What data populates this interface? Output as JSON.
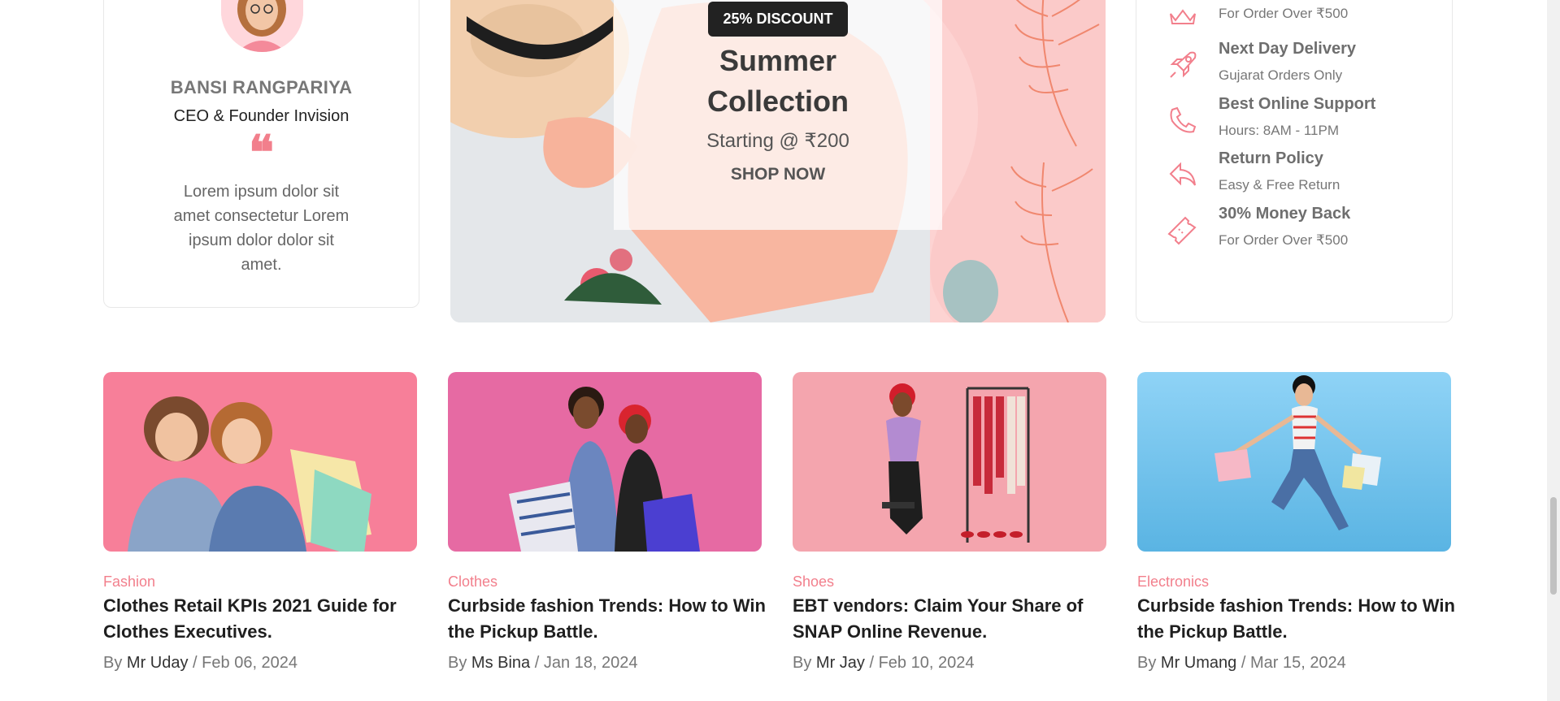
{
  "testimonial": {
    "name": "BANSI RANGPARIYA",
    "role": "CEO & Founder Invision",
    "quote_mark": "❝",
    "text": "Lorem ipsum dolor sit amet consectetur Lorem ipsum dolor dolor sit amet."
  },
  "banner": {
    "discount": "25% DISCOUNT",
    "title_line1": "Summer",
    "title_line2": "Collection",
    "subtitle": "Starting @ ₹200",
    "cta": "SHOP NOW"
  },
  "services": [
    {
      "title": "",
      "subtitle": "For Order Over ₹500",
      "icon": "crown-icon"
    },
    {
      "title": "Next Day Delivery",
      "subtitle": "Gujarat Orders Only",
      "icon": "rocket-icon"
    },
    {
      "title": "Best Online Support",
      "subtitle": "Hours: 8AM - 11PM",
      "icon": "phone-icon"
    },
    {
      "title": "Return Policy",
      "subtitle": "Easy & Free Return",
      "icon": "return-arrow-icon"
    },
    {
      "title": "30% Money Back",
      "subtitle": "For Order Over ₹500",
      "icon": "ticket-icon"
    }
  ],
  "posts": [
    {
      "category": "Fashion",
      "title": "Clothes Retail KPIs 2021 Guide for Clothes Executives.",
      "by": "By",
      "author": "Mr Uday",
      "date": "Feb 06, 2024"
    },
    {
      "category": "Clothes",
      "title": "Curbside fashion Trends: How to Win the Pickup Battle.",
      "by": "By",
      "author": "Ms Bina",
      "date": "Jan 18, 2024"
    },
    {
      "category": "Shoes",
      "title": "EBT vendors: Claim Your Share of SNAP Online Revenue.",
      "by": "By",
      "author": "Mr Jay",
      "date": "Feb 10, 2024"
    },
    {
      "category": "Electronics",
      "title": "Curbside fashion Trends: How to Win the Pickup Battle.",
      "by": "By",
      "author": "Mr Umang",
      "date": "Mar 15, 2024"
    }
  ],
  "meta_separator": "/",
  "colors": {
    "accent": "#f27f8c",
    "dark": "#222222"
  }
}
